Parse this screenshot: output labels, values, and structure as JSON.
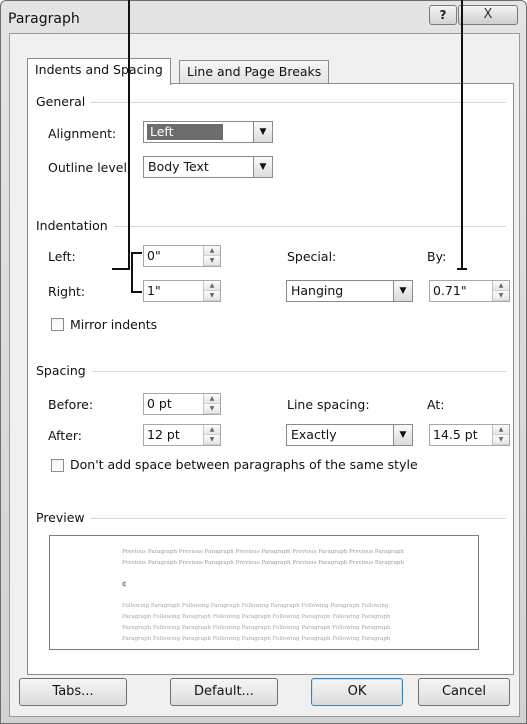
{
  "window": {
    "title": "Paragraph",
    "help_label": "?",
    "close_label": "X"
  },
  "tabs": [
    {
      "label": "Indents and Spacing",
      "active": true
    },
    {
      "label": "Line and Page Breaks",
      "active": false
    }
  ],
  "general": {
    "group_label": "General",
    "alignment_label": "Alignment:",
    "alignment_value": "Left",
    "outline_label": "Outline level:",
    "outline_value": "Body Text"
  },
  "indentation": {
    "group_label": "Indentation",
    "left_label": "Left:",
    "left_value": "0\"",
    "right_label": "Right:",
    "right_value": "1\"",
    "special_label": "Special:",
    "special_value": "Hanging",
    "by_label": "By:",
    "by_value": "0.71\"",
    "mirror_label": "Mirror indents"
  },
  "spacing": {
    "group_label": "Spacing",
    "before_label": "Before:",
    "before_value": "0 pt",
    "after_label": "After:",
    "after_value": "12 pt",
    "line_spacing_label": "Line spacing:",
    "line_spacing_value": "Exactly",
    "at_label": "At:",
    "at_value": "14.5 pt",
    "dont_add_label": "Don't add space between paragraphs of the same style"
  },
  "preview": {
    "group_label": "Preview",
    "previous_lines": [
      "Previous Paragraph Previous Paragraph Previous Paragraph Previous Paragraph Previous Paragraph",
      "Previous Paragraph Previous Paragraph Previous Paragraph Previous Paragraph Previous Paragraph"
    ],
    "current_mark": "¢",
    "following_lines": [
      "Following Paragraph Following Paragraph Following Paragraph Following Paragraph Following",
      "Paragraph Following Paragraph Following Paragraph Following Paragraph Following Paragraph",
      "Paragraph Following Paragraph Following Paragraph Following Paragraph Following Paragraph",
      "Paragraph Following Paragraph Following Paragraph Following Paragraph Following Paragraph"
    ]
  },
  "buttons": {
    "tabs": "Tabs...",
    "default": "Default...",
    "ok": "OK",
    "cancel": "Cancel"
  },
  "icons": {
    "dropdown": "▼",
    "spin_up": "▲",
    "spin_down": "▼"
  }
}
